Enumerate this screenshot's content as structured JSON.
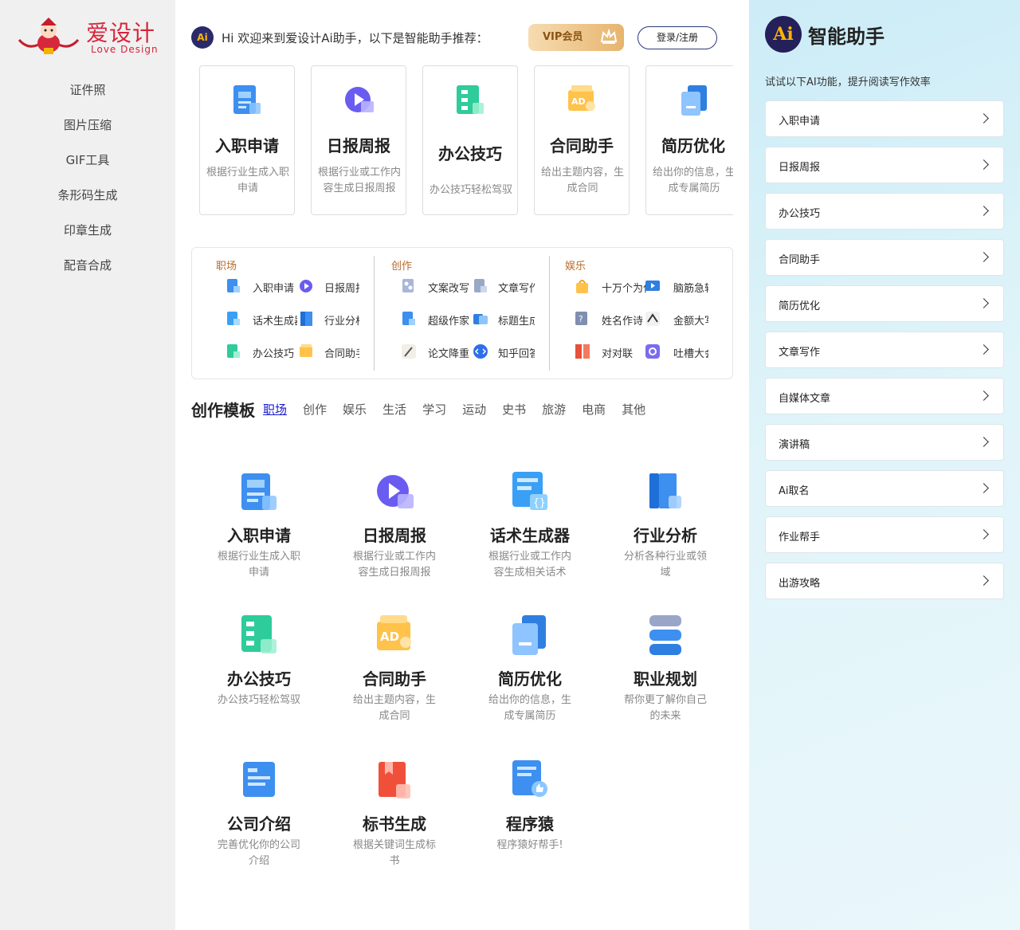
{
  "brand": {
    "title": "爱设计",
    "subtitle": "Love  Design"
  },
  "left_nav": [
    "证件照",
    "图片压缩",
    "GIF工具",
    "条形码生成",
    "印章生成",
    "配音合成"
  ],
  "header": {
    "badge": "Ai",
    "greeting": "Hi  欢迎来到爱设计Ai助手，以下是智能助手推荐：",
    "vip_label": "VIP会员",
    "login_label": "登录/注册"
  },
  "top_cards": [
    {
      "title": "入职申请",
      "desc": "根据行业生成入职申请",
      "icon": "document-blue-icon"
    },
    {
      "title": "日报周报",
      "desc": "根据行业或工作内容生成日报周报",
      "icon": "play-purple-icon"
    },
    {
      "title": "办公技巧",
      "desc": "办公技巧轻松驾驭",
      "icon": "flowchart-green-icon"
    },
    {
      "title": "合同助手",
      "desc": "给出主题内容，生成合同",
      "icon": "ad-orange-icon"
    },
    {
      "title": "简历优化",
      "desc": "给出你的信息，生成专属简历",
      "icon": "folder-blue-icon"
    }
  ],
  "categories": [
    {
      "name": "职场",
      "items": [
        "入职申请",
        "日报周报",
        "话术生成器",
        "行业分析",
        "办公技巧",
        "合同助手"
      ]
    },
    {
      "name": "创作",
      "items": [
        "文案改写",
        "文章写作",
        "超级作家",
        "标题生成",
        "论文降重",
        "知乎回答"
      ]
    },
    {
      "name": "娱乐",
      "items": [
        "十万个为什么",
        "脑筋急转弯",
        "姓名作诗",
        "金额大写",
        "对对联",
        "吐槽大会"
      ]
    }
  ],
  "templates": {
    "title": "创作模板",
    "tabs": [
      "职场",
      "创作",
      "娱乐",
      "生活",
      "学习",
      "运动",
      "史书",
      "旅游",
      "电商",
      "其他"
    ],
    "items": [
      {
        "title": "入职申请",
        "desc": "根据行业生成入职申请",
        "icon": "document-blue-icon"
      },
      {
        "title": "日报周报",
        "desc": "根据行业或工作内容生成日报周报",
        "icon": "play-purple-icon"
      },
      {
        "title": "话术生成器",
        "desc": "根据行业或工作内容生成相关话术",
        "icon": "braces-blue-icon"
      },
      {
        "title": "行业分析",
        "desc": "分析各种行业或领域",
        "icon": "book-blue-icon"
      },
      {
        "title": "办公技巧",
        "desc": "办公技巧轻松驾驭",
        "icon": "flowchart-green-icon"
      },
      {
        "title": "合同助手",
        "desc": "给出主题内容，生成合同",
        "icon": "ad-orange-icon"
      },
      {
        "title": "简历优化",
        "desc": "给出你的信息，生成专属简历",
        "icon": "folder-blue-icon"
      },
      {
        "title": "职业规划",
        "desc": "帮你更了解你自己的未来",
        "icon": "stack-blue-icon"
      },
      {
        "title": "公司介绍",
        "desc": "完善优化你的公司介绍",
        "icon": "card-blue-icon"
      },
      {
        "title": "标书生成",
        "desc": "根据关键词生成标书",
        "icon": "bookmark-red-icon"
      },
      {
        "title": "程序猿",
        "desc": "程序猿好帮手!",
        "icon": "thumb-blue-icon"
      }
    ]
  },
  "assistant": {
    "badge": "Ai",
    "title": "智能助手",
    "subtitle": "试试以下AI功能，提升阅读写作效率",
    "items": [
      "入职申请",
      "日报周报",
      "办公技巧",
      "合同助手",
      "简历优化",
      "文章写作",
      "自媒体文章",
      "演讲稿",
      "Ai取名",
      "作业帮手",
      "出游攻略"
    ]
  }
}
